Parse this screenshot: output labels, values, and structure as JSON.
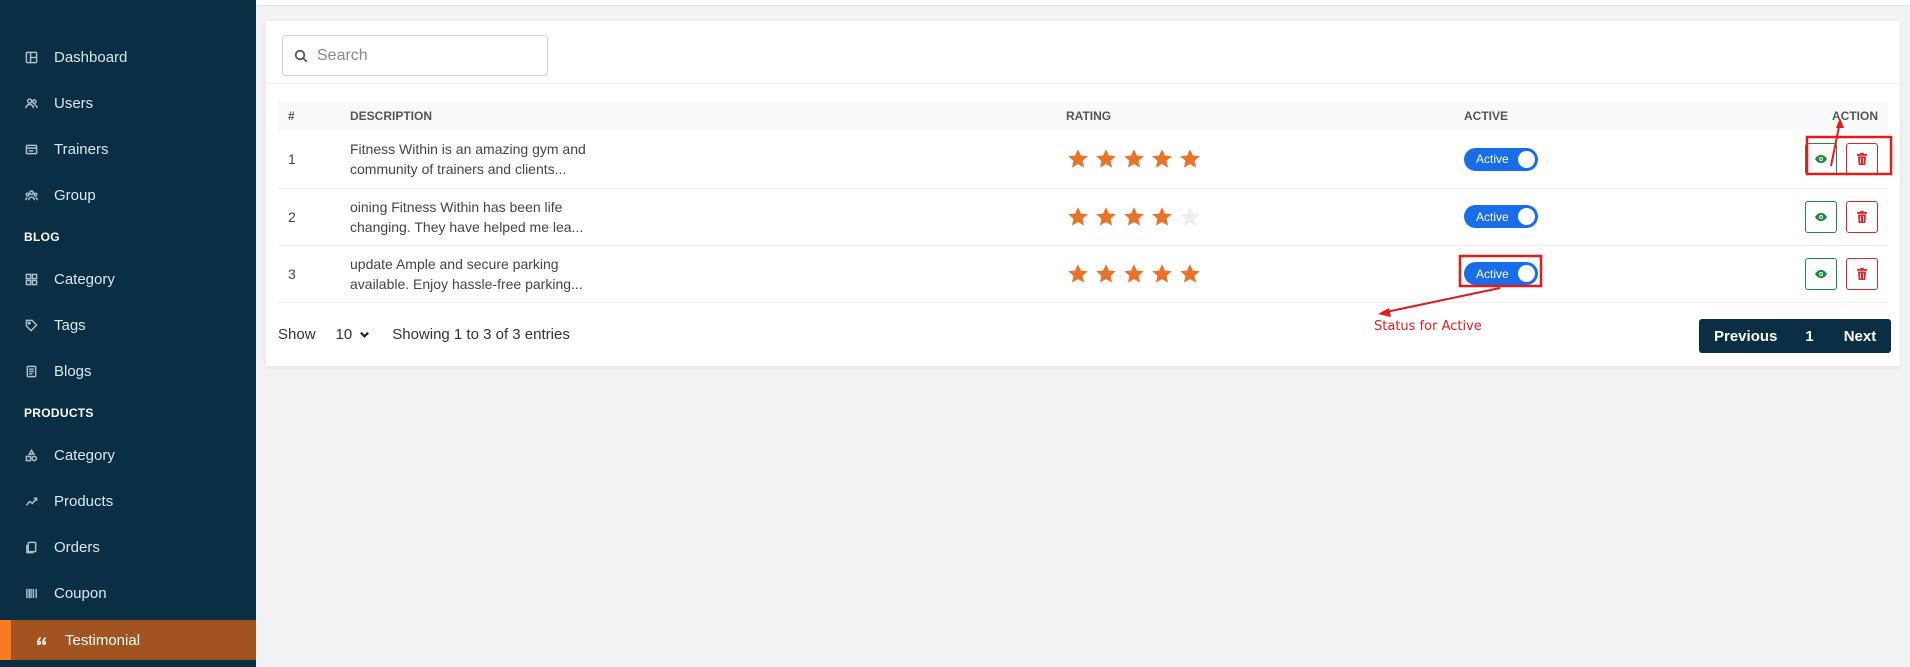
{
  "sidebar": {
    "items": [
      {
        "label": "Dashboard",
        "icon": "dashboard-icon"
      },
      {
        "label": "Users",
        "icon": "users-icon"
      },
      {
        "label": "Trainers",
        "icon": "trainers-icon"
      },
      {
        "label": "Group",
        "icon": "group-icon"
      }
    ],
    "blog_section": "BLOG",
    "blog_items": [
      {
        "label": "Category",
        "icon": "category-icon"
      },
      {
        "label": "Tags",
        "icon": "tag-icon"
      },
      {
        "label": "Blogs",
        "icon": "blog-icon"
      }
    ],
    "products_section": "PRODUCTS",
    "product_items": [
      {
        "label": "Category",
        "icon": "shapes-icon"
      },
      {
        "label": "Products",
        "icon": "products-icon"
      },
      {
        "label": "Orders",
        "icon": "orders-icon"
      },
      {
        "label": "Coupon",
        "icon": "barcode-icon"
      },
      {
        "label": "Testimonial",
        "icon": "quote-icon",
        "active": true
      }
    ]
  },
  "search": {
    "placeholder": "Search",
    "value": ""
  },
  "table": {
    "columns": [
      "#",
      "DESCRIPTION",
      "RATING",
      "ACTIVE",
      "ACTION"
    ],
    "rows": [
      {
        "num": "1",
        "desc_line1": "Fitness Within is an amazing gym and",
        "desc_line2": "community of trainers and clients...",
        "rating": 5,
        "status": "Active"
      },
      {
        "num": "2",
        "desc_line1": "oining Fitness Within has been life",
        "desc_line2": "changing. They have helped me lea...",
        "rating": 4,
        "status": "Active"
      },
      {
        "num": "3",
        "desc_line1": "update Ample and secure parking",
        "desc_line2": "available. Enjoy hassle-free parking...",
        "rating": 5,
        "status": "Active"
      }
    ]
  },
  "footer": {
    "show_label": "Show",
    "page_size": "10",
    "entries_text": "Showing 1 to 3 of 3 entries"
  },
  "pagination": {
    "prev": "Previous",
    "current": "1",
    "next": "Next"
  },
  "annotation": {
    "text": "Status for Active"
  },
  "colors": {
    "sidebar_bg": "#0a2f45",
    "active_item_bg": "#a3531f",
    "active_item_accent": "#f57c1f",
    "star_filled": "#e8732a",
    "star_empty": "#eceef0",
    "toggle_on": "#1a6de8",
    "view_button": "#1f8a3c",
    "delete_button": "#d62828",
    "annotation": "#e41b1b"
  }
}
